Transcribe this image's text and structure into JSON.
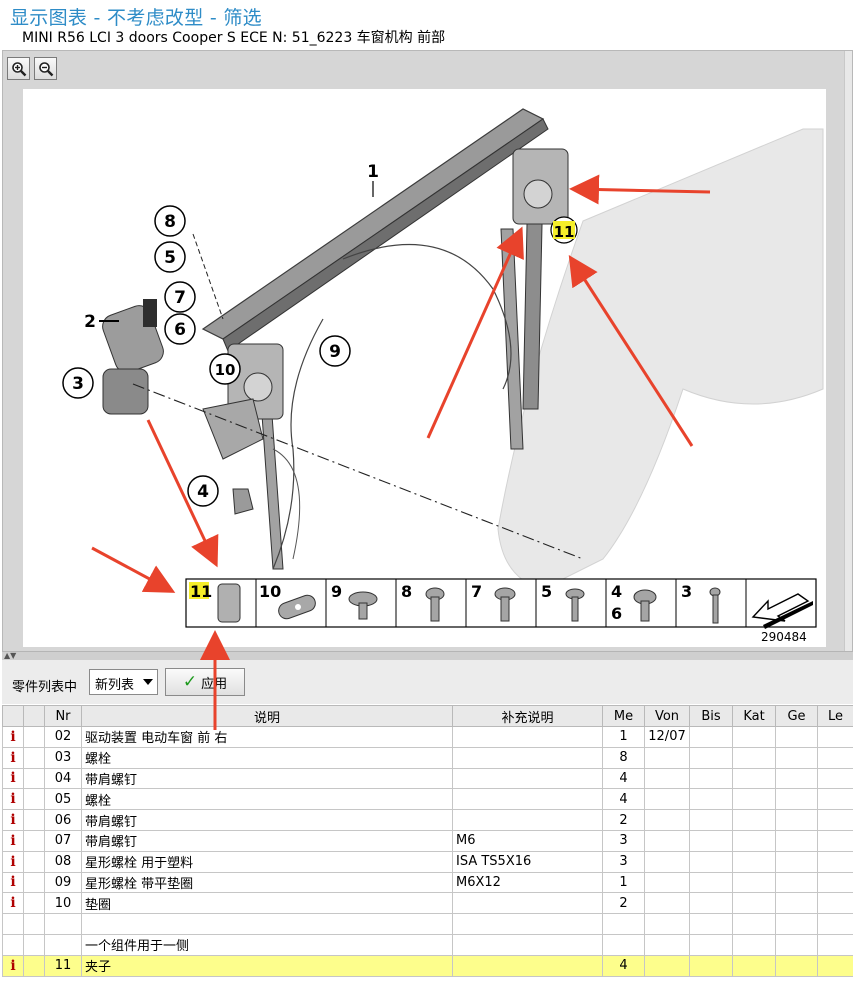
{
  "header": {
    "title": "显示图表 - 不考虑改型 - 筛选",
    "subtitle": "MINI R56 LCI 3 doors Cooper S ECE  N: 51_6223 车窗机构 前部"
  },
  "viewer": {
    "zoom_in": "zoom-in-icon",
    "zoom_out": "zoom-out-icon",
    "image_number": "290484",
    "callouts": [
      "1",
      "2",
      "3",
      "4",
      "5",
      "6",
      "7",
      "8",
      "9",
      "10",
      "11"
    ],
    "legend": [
      {
        "label": "11"
      },
      {
        "label": "10"
      },
      {
        "label": "9"
      },
      {
        "label": "8"
      },
      {
        "label": "7"
      },
      {
        "label": "5"
      },
      {
        "label": "4\n6"
      },
      {
        "label": "3"
      }
    ],
    "colors": {
      "highlight": "#f5ee2a",
      "arrow": "#e8432c"
    }
  },
  "toolbar": {
    "label": "零件列表中",
    "select_value": "新列表",
    "apply_label": "应用"
  },
  "table": {
    "headers": [
      "",
      "",
      "Nr",
      "说明",
      "补充说明",
      "Me",
      "Von",
      "Bis",
      "Kat",
      "Ge",
      "Le"
    ],
    "rows": [
      {
        "info": "i",
        "nr": "02",
        "desc": "驱动装置 电动车窗 前 右",
        "extra": "",
        "me": "1",
        "von": "12/07",
        "hl": false
      },
      {
        "info": "i",
        "nr": "03",
        "desc": "螺栓",
        "extra": "",
        "me": "8",
        "von": "",
        "hl": false
      },
      {
        "info": "i",
        "nr": "04",
        "desc": "带肩螺钉",
        "extra": "",
        "me": "4",
        "von": "",
        "hl": false
      },
      {
        "info": "i",
        "nr": "05",
        "desc": "螺栓",
        "extra": "",
        "me": "4",
        "von": "",
        "hl": false
      },
      {
        "info": "i",
        "nr": "06",
        "desc": "带肩螺钉",
        "extra": "",
        "me": "2",
        "von": "",
        "hl": false
      },
      {
        "info": "i",
        "nr": "07",
        "desc": "带肩螺钉",
        "extra": "M6",
        "me": "3",
        "von": "",
        "hl": false
      },
      {
        "info": "i",
        "nr": "08",
        "desc": "星形螺栓 用于塑料",
        "extra": "ISA TS5X16",
        "me": "3",
        "von": "",
        "hl": false
      },
      {
        "info": "i",
        "nr": "09",
        "desc": "星形螺栓 带平垫圈",
        "extra": "M6X12",
        "me": "1",
        "von": "",
        "hl": false
      },
      {
        "info": "i",
        "nr": "10",
        "desc": "垫圈",
        "extra": "",
        "me": "2",
        "von": "",
        "hl": false
      },
      {
        "info": "",
        "nr": "",
        "desc": "",
        "extra": "",
        "me": "",
        "von": "",
        "hl": false
      },
      {
        "info": "",
        "nr": "",
        "desc": "一个组件用于一侧",
        "extra": "",
        "me": "",
        "von": "",
        "hl": false
      },
      {
        "info": "i",
        "nr": "11",
        "desc": "夹子",
        "extra": "",
        "me": "4",
        "von": "",
        "hl": true
      }
    ]
  }
}
